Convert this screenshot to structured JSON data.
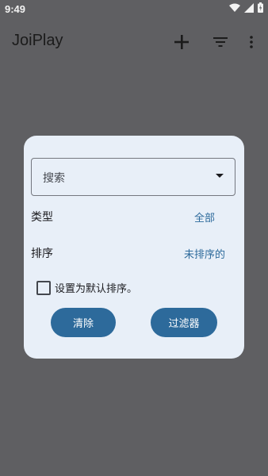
{
  "status_bar": {
    "time": "9:49"
  },
  "app_bar": {
    "title": "JoiPlay"
  },
  "dialog": {
    "search": {
      "label": "搜索"
    },
    "type_row": {
      "label": "类型",
      "value": "全部"
    },
    "sort_row": {
      "label": "排序",
      "value": "未排序的"
    },
    "default_checkbox": {
      "label": "设置为默认排序。",
      "checked": false
    },
    "clear_button": "清除",
    "filter_button": "过滤器"
  },
  "colors": {
    "accent": "#2d6a9b",
    "dialog_bg": "#e8eff8",
    "scrim_bg": "#5f5f62"
  },
  "icons": [
    "wifi-icon",
    "signal-icon",
    "battery-icon",
    "add-icon",
    "filter-list-icon",
    "more-vert-icon",
    "dropdown-arrow-icon"
  ]
}
